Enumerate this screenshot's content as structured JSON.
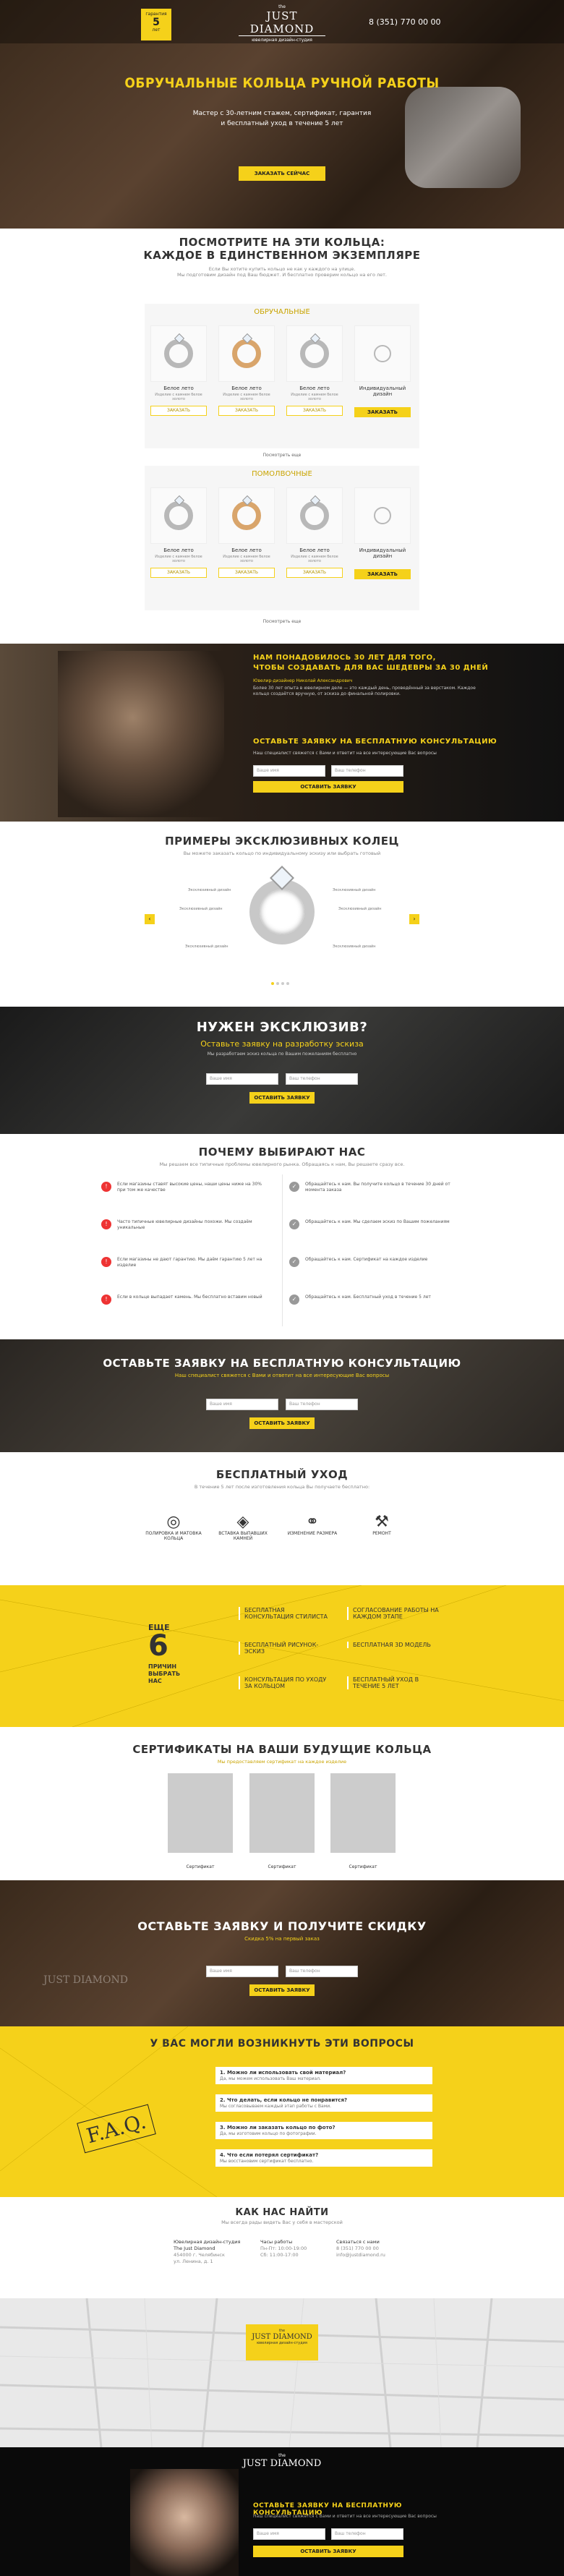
{
  "header": {
    "badge_top": "гарантия",
    "badge_num": "5",
    "badge_unit": "лет",
    "logo_top": "the",
    "logo_name": "JUST DIAMOND",
    "logo_tag": "ювелирная дизайн-студия",
    "phone": "8 (351) 770 00 00"
  },
  "hero": {
    "title": "ОБРУЧАЛЬНЫЕ КОЛЬЦА РУЧНОЙ РАБОТЫ",
    "line1": "Мастер с 30-летним стажем, сертификат, гарантия",
    "line2": "и бесплатный уход в течение 5 лет",
    "button": "ЗАКАЗАТЬ СЕЙЧАС"
  },
  "catalog": {
    "title_l1": "ПОСМОТРИТЕ НА ЭТИ КОЛЬЦА:",
    "title_l2": "КАЖДОЕ В ЕДИНСТВЕННОМ ЭКЗЕМПЛЯРЕ",
    "subtitle": "Если Вы хотите купить кольцо не как у каждого на улице.",
    "subtitle2": "Мы подготовим дизайн под Ваш бюджет. И бесплатно проверим кольцо на его лет.",
    "group1": "ОБРУЧАЛЬНЫЕ",
    "group2": "ПОМОЛВОЧНЫЕ",
    "ring_name": "Белое лето",
    "ring_desc": "Изделие с камнем белое золото",
    "custom_name": "Индивидуальный дизайн",
    "order": "ЗАКАЗАТЬ",
    "more": "Посмотреть еще"
  },
  "master": {
    "title_l1": "НАМ ПОНАДОБИЛОСЬ 30 ЛЕТ ДЛЯ ТОГО,",
    "title_l2": "ЧТОБЫ СОЗДАВАТЬ ДЛЯ ВАС ШЕДЕВРЫ ЗА 30 ДНЕЙ",
    "name": "Ювелир-дизайнер Николай Александрович",
    "text": "Более 30 лет опыта в ювелирном деле — это каждый день, проведённый за верстаком. Каждое кольцо создаётся вручную, от эскиза до финальной полировки.",
    "form_title": "ОСТАВЬТЕ ЗАЯВКУ НА БЕСПЛАТНУЮ КОНСУЛЬТАЦИЮ",
    "form_sub": "Наш специалист свяжется с Вами и ответит на все интересующие Вас вопросы",
    "name_ph": "Ваше имя",
    "phone_ph": "Ваш телефон",
    "button": "ОСТАВИТЬ ЗАЯВКУ"
  },
  "examples": {
    "title": "ПРИМЕРЫ ЭКСКЛЮЗИВНЫХ КОЛЕЦ",
    "sub": "Вы можете заказать кольцо по индивидуальному эскизу или выбрать готовый",
    "labels": [
      "Эксклюзивный дизайн",
      "Эксклюзивный дизайн",
      "Эксклюзивный дизайн",
      "Эксклюзивный дизайн",
      "Эксклюзивный дизайн",
      "Эксклюзивный дизайн"
    ]
  },
  "exclusive": {
    "title": "НУЖЕН ЭКСКЛЮЗИВ?",
    "sub": "Оставьте заявку на разработку эскиза",
    "note": "Мы разработаем эскиз кольца по Вашим пожеланиям бесплатно",
    "name_ph": "Ваше имя",
    "phone_ph": "Ваш телефон",
    "button": "ОСТАВИТЬ ЗАЯВКУ"
  },
  "why": {
    "title": "ПОЧЕМУ ВЫБИРАЮТ НАС",
    "sub": "Мы решаем все типичные проблемы ювелирного рынка. Обращаясь к нам, Вы решаете сразу все.",
    "left": [
      "Если магазины ставят высокие цены, наши цены ниже на 30% при том же качестве",
      "Часто типичные ювелирные дизайны похожи. Мы создаём уникальные",
      "Если магазины не дают гарантию. Мы даём гарантию 5 лет на изделие",
      "Если в кольце выпадает камень. Мы бесплатно вставим новый"
    ],
    "right": [
      "Обращайтесь к нам. Вы получите кольцо в течение 30 дней от момента заказа",
      "Обращайтесь к нам. Мы сделаем эскиз по Вашим пожеланиям",
      "Обращайтесь к нам. Сертификат на каждое изделие",
      "Обращайтесь к нам. Бесплатный уход в течение 5 лет"
    ]
  },
  "consult": {
    "title": "ОСТАВЬТЕ ЗАЯВКУ НА БЕСПЛАТНУЮ КОНСУЛЬТАЦИЮ",
    "sub": "Наш специалист свяжется с Вами и ответит на все интересующие Вас вопросы",
    "name_ph": "Ваше имя",
    "phone_ph": "Ваш телефон",
    "button": "ОСТАВИТЬ ЗАЯВКУ"
  },
  "care": {
    "title": "БЕСПЛАТНЫЙ УХОД",
    "sub": "В течение 5 лет после изготовления кольца Вы получаете бесплатно:",
    "items": [
      "ПОЛИРОВКА И МАТОВКА КОЛЬЦА",
      "ВСТАВКА ВЫПАВШИХ КАМНЕЙ",
      "ИЗМЕНЕНИЕ РАЗМЕРА",
      "РЕМОНТ"
    ]
  },
  "reasons": {
    "label_top": "ЕЩЕ",
    "num": "6",
    "label_bot": "ПРИЧИН ВЫБРАТЬ НАС",
    "items": [
      "БЕСПЛАТНАЯ КОНСУЛЬТАЦИЯ СТИЛИСТА",
      "СОГЛАСОВАНИЕ РАБОТЫ НА КАЖДОМ ЭТАПЕ",
      "БЕСПЛАТНЫЙ РИСУНОК-ЭСКИЗ",
      "БЕСПЛАТНАЯ 3D МОДЕЛЬ",
      "КОНСУЛЬТАЦИЯ ПО УХОДУ ЗА КОЛЬЦОМ",
      "БЕСПЛАТНЫЙ УХОД В ТЕЧЕНИЕ 5 ЛЕТ"
    ]
  },
  "certs": {
    "title": "СЕРТИФИКАТЫ НА ВАШИ БУДУЩИЕ КОЛЬЦА",
    "sub": "Мы предоставляем сертификат на каждое изделие",
    "labels": [
      "Сертификат",
      "Сертификат",
      "Сертификат"
    ]
  },
  "discount": {
    "title": "ОСТАВЬТЕ ЗАЯВКУ И ПОЛУЧИТЕ СКИДКУ",
    "sub": "Скидка 5% на первый заказ",
    "name_ph": "Ваше имя",
    "phone_ph": "Ваш телефон",
    "button": "ОСТАВИТЬ ЗАЯВКУ"
  },
  "faq": {
    "title": "У ВАС МОГЛИ ВОЗНИКНУТЬ ЭТИ ВОПРОСЫ",
    "logo": "F.A.Q.",
    "items": [
      {
        "q": "1. Можно ли использовать свой материал?",
        "a": "Да, мы можем использовать Ваш материал."
      },
      {
        "q": "2. Что делать, если кольцо не понравится?",
        "a": "Мы согласовываем каждый этап работы с Вами."
      },
      {
        "q": "3. Можно ли заказать кольцо по фото?",
        "a": "Да, мы изготовим кольцо по фотографии."
      },
      {
        "q": "4. Что если потерял сертификат?",
        "a": "Мы восстановим сертификат бесплатно."
      }
    ]
  },
  "contacts": {
    "title": "КАК НАС НАЙТИ",
    "sub": "Мы всегда рады видеть Вас у себя в мастерской",
    "col1": [
      "Ювелирная дизайн-студия",
      "The Just Diamond",
      "",
      "454000 г. Челябинск",
      "ул. Ленина, д. 1"
    ],
    "col2": [
      "Часы работы",
      "",
      "Пн-Пт: 10:00-19:00",
      "Сб: 11:00-17:00"
    ],
    "col3": [
      "Связаться с нами",
      "",
      "8 (351) 770 00 00",
      "info@justdiamond.ru"
    ]
  },
  "footer": {
    "logo_top": "the",
    "logo_name": "JUST DIAMOND",
    "form_title": "ОСТАВЬТЕ ЗАЯВКУ НА БЕСПЛАТНУЮ КОНСУЛЬТАЦИЮ",
    "form_sub": "Наш специалист свяжется с Вами и ответит на все интересующие Вас вопросы",
    "name_ph": "Ваше имя",
    "phone_ph": "Ваш телефон",
    "button": "ОСТАВИТЬ ЗАЯВКУ"
  }
}
